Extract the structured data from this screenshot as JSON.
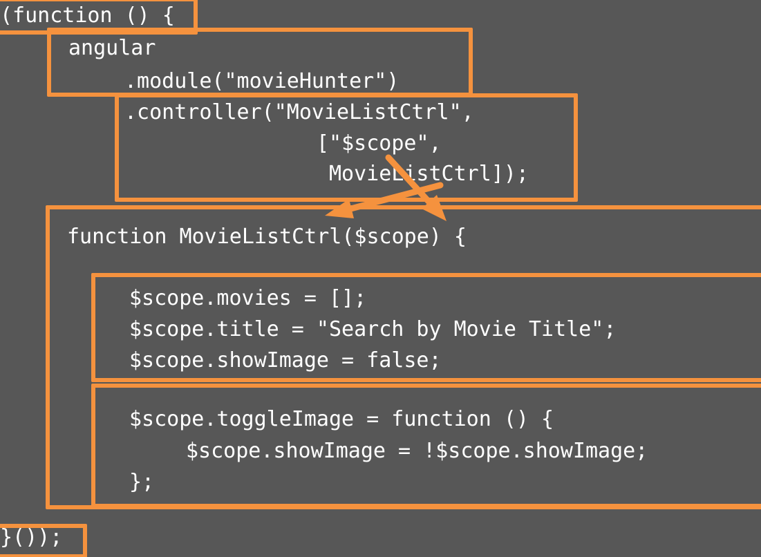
{
  "code": {
    "iife_open": "(function () {",
    "angular": "angular",
    "module_call": ".module(\"movieHunter\")",
    "controller_call": ".controller(\"MovieListCtrl\",",
    "deps_scope": "[\"$scope\",",
    "deps_ctrl": "MovieListCtrl]);",
    "function_decl": "function MovieListCtrl($scope) {",
    "movies_assign": "$scope.movies = [];",
    "title_assign": "$scope.title = \"Search by Movie Title\";",
    "show_image_assign": "$scope.showImage = false;",
    "toggle_image_decl": "$scope.toggleImage = function () {",
    "toggle_image_body": "$scope.showImage = !$scope.showImage;",
    "toggle_image_close": "};",
    "iife_close": "}());"
  },
  "colors": {
    "background": "#575757",
    "text": "#ffffff",
    "highlight": "#f5923e"
  }
}
